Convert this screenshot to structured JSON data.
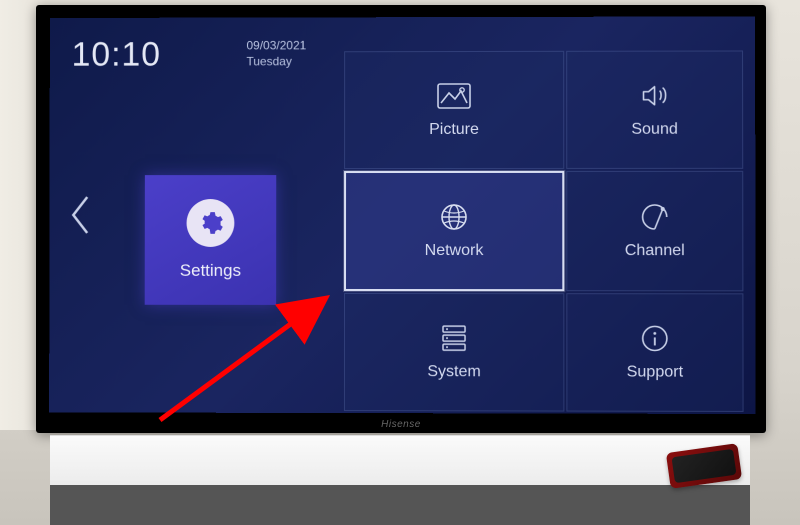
{
  "header": {
    "time": "10:10",
    "date": "09/03/2021",
    "day": "Tuesday"
  },
  "sidebar": {
    "current_label": "Settings"
  },
  "tiles": [
    {
      "id": "picture",
      "label": "Picture",
      "selected": false
    },
    {
      "id": "sound",
      "label": "Sound",
      "selected": false
    },
    {
      "id": "network",
      "label": "Network",
      "selected": true
    },
    {
      "id": "channel",
      "label": "Channel",
      "selected": false
    },
    {
      "id": "system",
      "label": "System",
      "selected": false
    },
    {
      "id": "support",
      "label": "Support",
      "selected": false
    }
  ],
  "brand": "Hisense"
}
